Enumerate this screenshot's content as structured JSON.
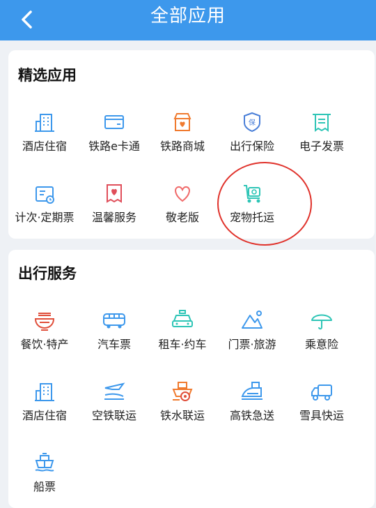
{
  "header": {
    "title": "全部应用"
  },
  "featured": {
    "title": "精选应用",
    "items": [
      {
        "label": "酒店住宿",
        "icon": "hotel-building-icon"
      },
      {
        "label": "铁路e卡通",
        "icon": "card-icon"
      },
      {
        "label": "铁路商城",
        "icon": "shop-icon"
      },
      {
        "label": "出行保险",
        "icon": "insurance-shield-icon"
      },
      {
        "label": "电子发票",
        "icon": "invoice-icon"
      },
      {
        "label": "计次·定期票",
        "icon": "calendar-ticket-icon"
      },
      {
        "label": "温馨服务",
        "icon": "heart-ticket-icon"
      },
      {
        "label": "敬老版",
        "icon": "heart-icon"
      },
      {
        "label": "宠物托运",
        "icon": "pet-carrier-icon"
      }
    ]
  },
  "travel": {
    "title": "出行服务",
    "items": [
      {
        "label": "餐饮·特产",
        "icon": "noodle-bowl-icon"
      },
      {
        "label": "汽车票",
        "icon": "bus-icon"
      },
      {
        "label": "租车·约车",
        "icon": "taxi-icon"
      },
      {
        "label": "门票·旅游",
        "icon": "mountain-icon"
      },
      {
        "label": "乘意险",
        "icon": "umbrella-icon"
      },
      {
        "label": "酒店住宿",
        "icon": "hotel-building-icon"
      },
      {
        "label": "空铁联运",
        "icon": "plane-train-icon"
      },
      {
        "label": "铁水联运",
        "icon": "ship-train-icon"
      },
      {
        "label": "高铁急送",
        "icon": "high-speed-train-icon"
      },
      {
        "label": "雪具快运",
        "icon": "delivery-truck-icon"
      },
      {
        "label": "船票",
        "icon": "ship-icon"
      }
    ]
  },
  "colors": {
    "header": "#3d98ec",
    "annotation": "#e0322b"
  }
}
